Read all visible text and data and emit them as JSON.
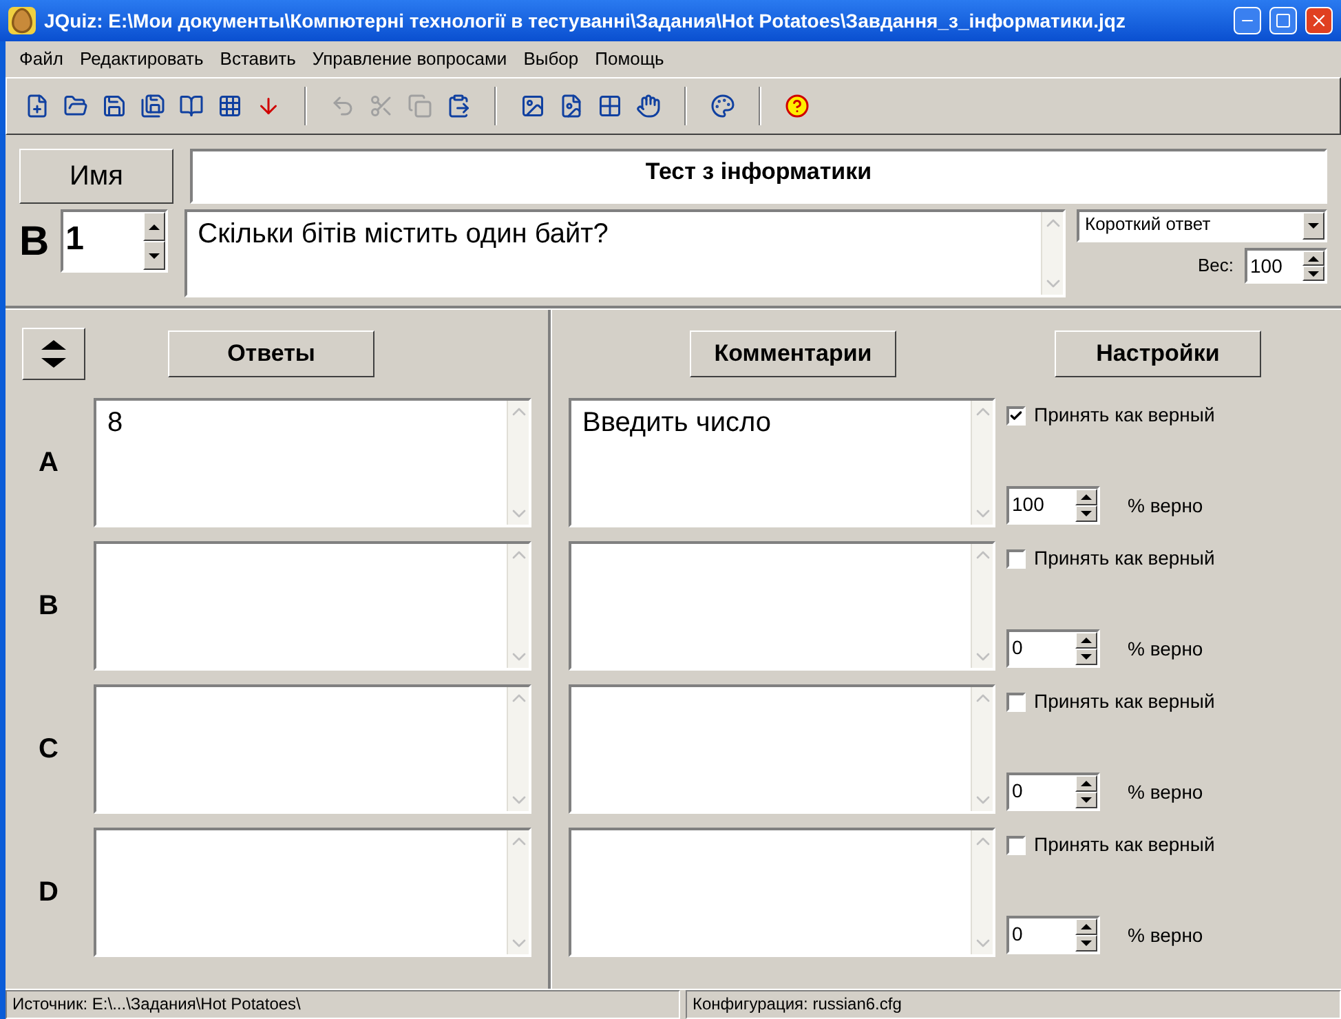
{
  "window": {
    "title": "JQuiz: E:\\Мои документы\\Компютерні технології в тестуванні\\Задания\\Hot Potatoes\\Завдання_з_інформатики.jqz"
  },
  "menu": [
    "Файл",
    "Редактировать",
    "Вставить",
    "Управление вопросами",
    "Выбор",
    "Помощь"
  ],
  "toolbar": [
    [
      {
        "disabled": false
      },
      {
        "disabled": false
      },
      {
        "disabled": false
      },
      {
        "disabled": false
      },
      {
        "disabled": false
      },
      {
        "disabled": false
      },
      {
        "disabled": false
      }
    ],
    [
      {
        "disabled": true
      },
      {
        "disabled": true
      },
      {
        "disabled": true
      },
      {
        "disabled": false
      }
    ],
    [
      {
        "disabled": false
      },
      {
        "disabled": false
      },
      {
        "disabled": false
      },
      {
        "disabled": false
      }
    ],
    [
      {
        "disabled": false
      }
    ],
    [
      {
        "disabled": false
      }
    ]
  ],
  "name_button": "Имя",
  "quiz_title": "Тест з інформатики",
  "question": {
    "label": "В",
    "number": "1",
    "text": "Скільки бітів містить один байт?",
    "type": "Короткий ответ",
    "weight_label": "Вес:",
    "weight": "100"
  },
  "answers_button": "Ответы",
  "comments_button": "Комментарии",
  "settings_button": "Настройки",
  "answers": [
    {
      "letter": "A",
      "text": "8",
      "comment": "Введить число",
      "accept_label": "Принять как верный",
      "accepted": true,
      "percent": "100",
      "percent_label": "% верно"
    },
    {
      "letter": "B",
      "accept_label": "Принять как верный",
      "accepted": false,
      "percent": "0",
      "percent_label": "% верно"
    },
    {
      "letter": "C",
      "accept_label": "Принять как верный",
      "accepted": false,
      "percent": "0",
      "percent_label": "% верно"
    },
    {
      "letter": "D",
      "accept_label": "Принять как верный",
      "accepted": false,
      "percent": "0",
      "percent_label": "% верно"
    }
  ],
  "status_bar": [
    "Источник: E:\\...\\Задания\\Hot Potatoes\\",
    "Конфигурация: russian6.cfg"
  ]
}
